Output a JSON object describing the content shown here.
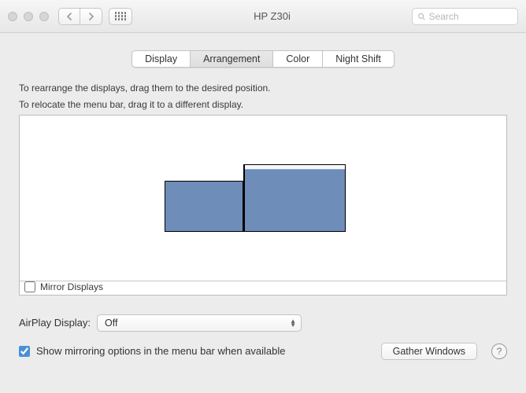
{
  "window": {
    "title": "HP Z30i",
    "search_placeholder": "Search"
  },
  "tabs": [
    {
      "label": "Display",
      "active": false
    },
    {
      "label": "Arrangement",
      "active": true
    },
    {
      "label": "Color",
      "active": false
    },
    {
      "label": "Night Shift",
      "active": false
    }
  ],
  "instructions": {
    "line1": "To rearrange the displays, drag them to the desired position.",
    "line2": "To relocate the menu bar, drag it to a different display."
  },
  "mirror": {
    "label": "Mirror Displays",
    "checked": false
  },
  "airplay": {
    "label": "AirPlay Display:",
    "value": "Off"
  },
  "show_mirroring": {
    "label": "Show mirroring options in the menu bar when available",
    "checked": true
  },
  "gather_button": "Gather Windows",
  "help_symbol": "?"
}
